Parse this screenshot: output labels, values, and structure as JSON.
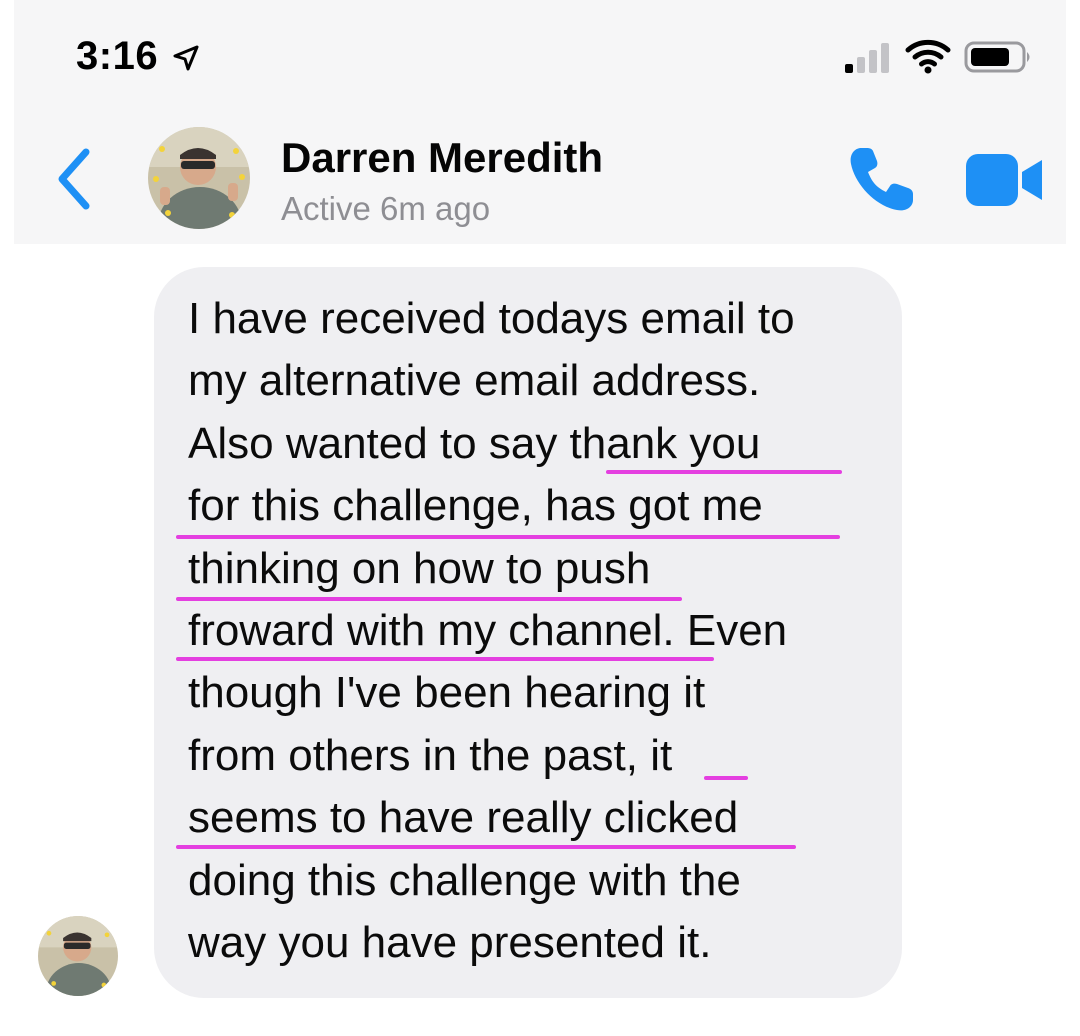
{
  "status_bar": {
    "time": "3:16"
  },
  "header": {
    "contact_name": "Darren Meredith",
    "active_status": "Active 6m ago"
  },
  "message": {
    "lines": [
      "I have received todays email to",
      "my alternative email address.",
      "Also wanted to say thank you",
      "for this challenge, has got me",
      "thinking on how to push",
      "froward with my channel. Even",
      "though I've been hearing it",
      "from others in the past, it",
      "seems to have really clicked",
      "doing this challenge with the",
      "way you have presented it."
    ],
    "highlighted_phrases": [
      "thank you",
      "for this challenge, has got me",
      "thinking on how to push",
      "froward with my channel",
      "it",
      "seems to have really clicked"
    ]
  },
  "colors": {
    "accent_blue": "#1e90f5",
    "bubble_bg": "#efeff2",
    "annotation_magenta": "#e43fe0",
    "header_bg": "#f6f6f7"
  },
  "icons": {
    "location": "location-arrow-icon",
    "signal": "cellular-signal-icon",
    "wifi": "wifi-icon",
    "battery": "battery-icon",
    "back": "chevron-left-icon",
    "call": "phone-icon",
    "video": "video-camera-icon"
  }
}
